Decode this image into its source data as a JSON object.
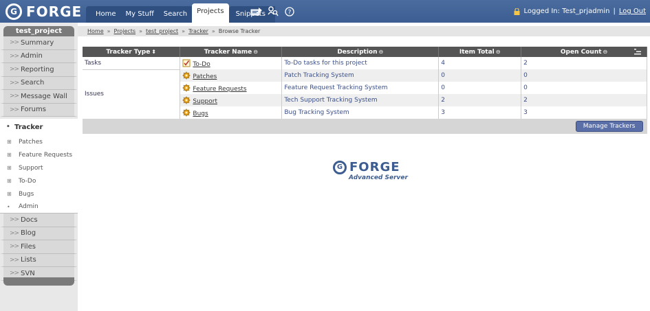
{
  "header": {
    "logo_glyph": "G",
    "logo_text": "FORGE",
    "nav_tabs": [
      "Home",
      "My Stuff",
      "Search",
      "Projects",
      "Snippets"
    ],
    "active_tab": "Projects",
    "user_label": "Logged In: Test_prjadmin",
    "separator": "|",
    "logout_label": "Log Out",
    "icons": [
      "ticket-icon",
      "search-person-icon",
      "help-icon"
    ]
  },
  "sidebar": {
    "project_name": "test_project",
    "chevron": ">>",
    "top_items": [
      "Summary",
      "Admin",
      "Reporting",
      "Search",
      "Message Wall",
      "Forums"
    ],
    "current_item": "Tracker",
    "current_bullet": "•",
    "sub_items": [
      "Patches",
      "Feature Requests",
      "Support",
      "To-Do",
      "Bugs"
    ],
    "sub_bullet": "⊞",
    "admin_item": "Admin",
    "bottom_items": [
      "Docs",
      "Blog",
      "Files",
      "Lists",
      "SVN"
    ]
  },
  "breadcrumb": {
    "items": [
      "Home",
      "Projects",
      "test_project",
      "Tracker"
    ],
    "separator": "»",
    "current": "Browse Tracker"
  },
  "table": {
    "columns": [
      "Tracker Type",
      "Tracker Name",
      "Description",
      "Item Total",
      "Open Count"
    ],
    "sort_glyph_active": "⬍",
    "sort_glyph": "⊖",
    "rows": [
      {
        "type": "Tasks",
        "name": "To-Do",
        "description": "To-Do tasks for this project",
        "item_total": "4",
        "open_count": "2"
      },
      {
        "type": "Issues",
        "name": "Patches",
        "description": "Patch Tracking System",
        "item_total": "0",
        "open_count": "0"
      },
      {
        "type": "",
        "name": "Feature Requests",
        "description": "Feature Request Tracking System",
        "item_total": "0",
        "open_count": "0"
      },
      {
        "type": "",
        "name": "Support",
        "description": "Tech Support Tracking System",
        "item_total": "2",
        "open_count": "2"
      },
      {
        "type": "",
        "name": "Bugs",
        "description": "Bug Tracking System",
        "item_total": "3",
        "open_count": "3"
      }
    ],
    "manage_button": "Manage Trackers"
  },
  "footer": {
    "logo_glyph": "G",
    "logo_text": "FORGE",
    "tagline": "Advanced Server"
  },
  "colors": {
    "header_bg": "#3b5d92",
    "table_header_bg": "#555555",
    "accent": "#5a6fa8"
  }
}
